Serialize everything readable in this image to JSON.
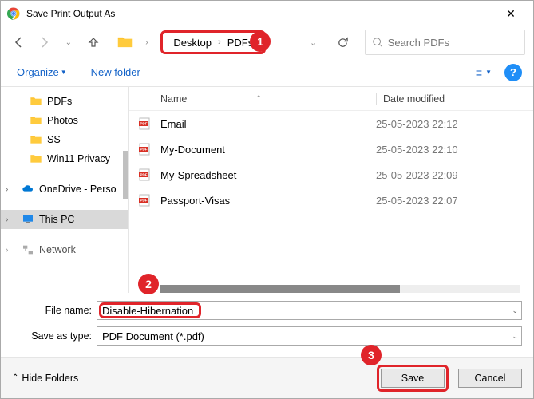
{
  "title": "Save Print Output As",
  "breadcrumbs": {
    "folder": "Desktop",
    "sub": "PDFs"
  },
  "search_placeholder": "Search PDFs",
  "toolbar": {
    "organize": "Organize",
    "newfolder": "New folder"
  },
  "sidebar": {
    "items": [
      "PDFs",
      "Photos",
      "SS",
      "Win11 Privacy"
    ],
    "onedrive": "OneDrive - Perso",
    "thispc": "This PC",
    "network": "Network"
  },
  "columns": {
    "name": "Name",
    "date": "Date modified"
  },
  "files": [
    {
      "name": "Email",
      "date": "25-05-2023 22:12"
    },
    {
      "name": "My-Document",
      "date": "25-05-2023 22:10"
    },
    {
      "name": "My-Spreadsheet",
      "date": "25-05-2023 22:09"
    },
    {
      "name": "Passport-Visas",
      "date": "25-05-2023 22:07"
    }
  ],
  "form": {
    "filename_label": "File name:",
    "filename_value": "Disable-Hibernation",
    "type_label": "Save as type:",
    "type_value": "PDF Document (*.pdf)"
  },
  "footer": {
    "hide": "Hide Folders",
    "save": "Save",
    "cancel": "Cancel"
  },
  "callouts": {
    "c1": "1",
    "c2": "2",
    "c3": "3"
  }
}
